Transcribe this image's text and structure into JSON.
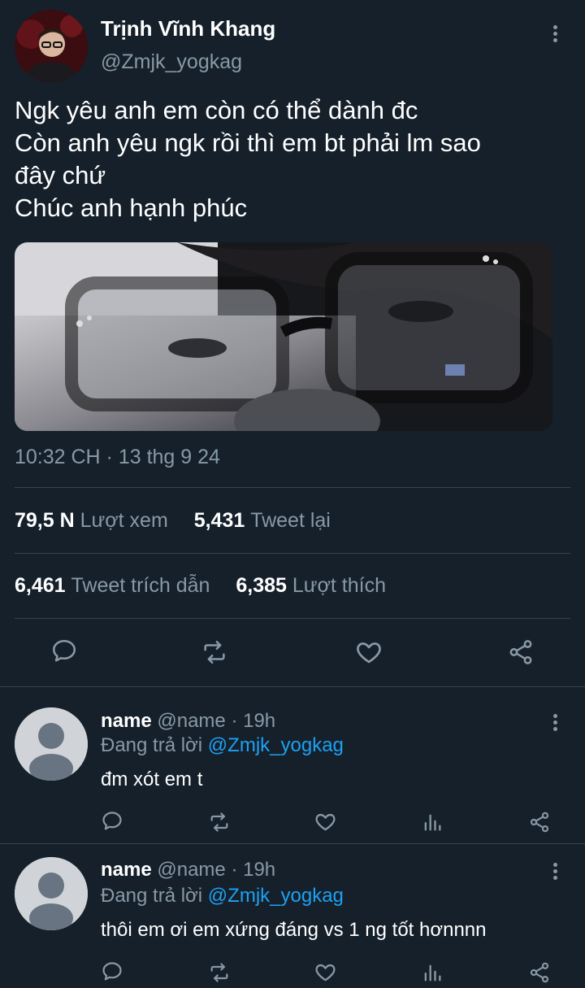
{
  "tweet": {
    "author_name": "Trịnh Vĩnh Khang",
    "author_handle": "@Zmjk_yogkag",
    "lines": [
      "Ngk yêu anh em còn có thể dành đc",
      "Còn anh yêu ngk rồi thì em bt phải lm sao",
      "đây chứ",
      "Chúc anh hạnh phúc"
    ],
    "timestamp": "10:32 CH · 13 thg 9 24",
    "stats": {
      "views_count": "79,5 N",
      "views_label": "Lượt xem",
      "retweets_count": "5,431",
      "retweets_label": "Tweet lại",
      "quotes_count": "6,461",
      "quotes_label": "Tweet trích dẫn",
      "likes_count": "6,385",
      "likes_label": "Lượt thích"
    },
    "actions": [
      "reply-icon",
      "retweet-icon",
      "like-icon",
      "share-icon"
    ]
  },
  "replies": [
    {
      "name": "name",
      "handle": "@name",
      "time": "· 19h",
      "replying_prefix": "Đang trả lời",
      "replying_to": "@Zmjk_yogkag",
      "text": "đm xót em t"
    },
    {
      "name": "name",
      "handle": "@name",
      "time": "· 19h",
      "replying_prefix": "Đang trả lời",
      "replying_to": "@Zmjk_yogkag",
      "text": "thôi em ơi em xứng đáng vs 1 ng tốt hơnnnn"
    }
  ],
  "colors": {
    "background": "#15202b",
    "muted_text": "#8899a6",
    "link": "#1da1f2",
    "divider": "#38444d"
  }
}
